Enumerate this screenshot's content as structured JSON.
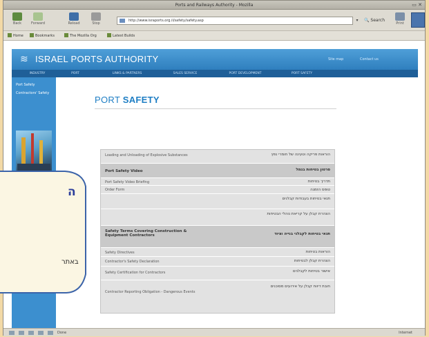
{
  "browser": {
    "window_title": "Ports and Railways Authority - Mozilla",
    "toolbar": {
      "back_label": "Back",
      "forward_label": "Forward",
      "reload_label": "Reload",
      "stop_label": "Stop",
      "url": "http://www.israports.org.il/safety/safety.asp",
      "search_label": "Search",
      "print_label": "Print"
    },
    "bookmarks": [
      "Home",
      "Bookmarks",
      "The Mozilla Org",
      "Latest Builds"
    ],
    "status": {
      "text": "Done",
      "zone": "Internet"
    }
  },
  "site": {
    "name": "ISRAEL PORTS AUTHORITY",
    "header_links": [
      "Site map",
      "Contact us"
    ],
    "nav": [
      "INDUSTRY",
      "PORT",
      "LINKS & PARTNERS",
      "SALES SERVICE",
      "PORT DEVELOPMENT",
      "PORT SAFETY"
    ],
    "sidebar": [
      "Port Safety",
      "Contractors' Safety"
    ]
  },
  "page": {
    "title_prefix": "PORT",
    "title_strong": "SAFETY",
    "table": {
      "rows": [
        {
          "left": "Loading and Unloading of Explosive Substances",
          "right": "הוראות פריקה וטעינה של חומרי נפץ",
          "header": false
        },
        {
          "left": "Port Safety Video",
          "right": "סרטון בטיחות בנמל",
          "header": true
        },
        {
          "left": "Port Safety Video Briefing",
          "right": "תדריך בטיחות",
          "header": false
        },
        {
          "left": "Order Form",
          "right": "טופס הזמנה",
          "header": false
        },
        {
          "left": "",
          "right": "תנאי בטיחות בעבודות קבלנים",
          "header": false
        },
        {
          "left": "",
          "right": "הצהרת קבלן על קריאת נוהלי הבטיחות",
          "header": false
        },
        {
          "left": "Safety Terms Covering Construction & Equipment Contractors",
          "right": "תנאי בטיחות לקבלני בנייה וציוד",
          "header": true
        },
        {
          "left": "Safety Directives",
          "right": "הוראות בטיחות",
          "header": false
        },
        {
          "left": "Contractor's Safety Declaration",
          "right": "הצהרת קבלן לבטיחות",
          "header": false
        },
        {
          "left": "Safety Certification for Contractors",
          "right": "אישור בטיחות לקבלנים",
          "header": false
        },
        {
          "left": "Contractor Reporting Obligation - Dangerous Events",
          "right": "חובת דיווח קבלן על אירועים מסוכנים",
          "header": false
        }
      ]
    }
  },
  "callout": {
    "heading": "ה",
    "text": "באתר"
  }
}
